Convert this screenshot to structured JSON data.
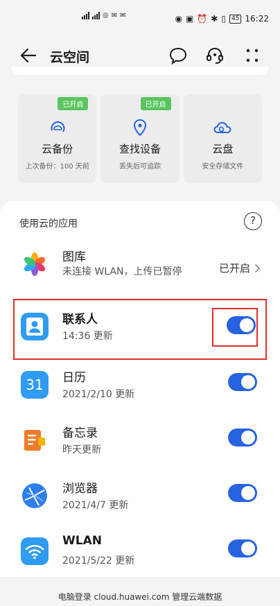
{
  "status_bar": {
    "time": "16:22",
    "battery": "45"
  },
  "header": {
    "title": "云空间"
  },
  "features": [
    {
      "badge": "已开启",
      "name": "云备份",
      "sub": "上次备份：100 天前"
    },
    {
      "badge": "已开启",
      "name": "查找设备",
      "sub": "丢失后可追踪"
    },
    {
      "badge": "",
      "name": "云盘",
      "sub": "安全存储文件"
    }
  ],
  "apps_section": {
    "title": "使用云的应用",
    "help_label": "?"
  },
  "apps": [
    {
      "name": "图库",
      "desc": "未连接 WLAN，上传已暂停",
      "status": "已开启"
    },
    {
      "name": "联系人",
      "desc": "14:36 更新",
      "toggle_on": true
    },
    {
      "name": "日历",
      "desc": "2021/2/10 更新",
      "icon_text": "31",
      "toggle_on": true
    },
    {
      "name": "备忘录",
      "desc": "昨天更新",
      "toggle_on": true
    },
    {
      "name": "浏览器",
      "desc": "2021/4/7 更新",
      "toggle_on": true
    },
    {
      "name": "WLAN",
      "desc": "2021/5/22 更新",
      "toggle_on": true
    }
  ],
  "footer": "电脑登录 cloud.huawei.com 管理云端数据",
  "colors": {
    "toggle_on": "#2763e0",
    "badge_green": "#5ac55f",
    "highlight_red": "#e22d2d"
  }
}
